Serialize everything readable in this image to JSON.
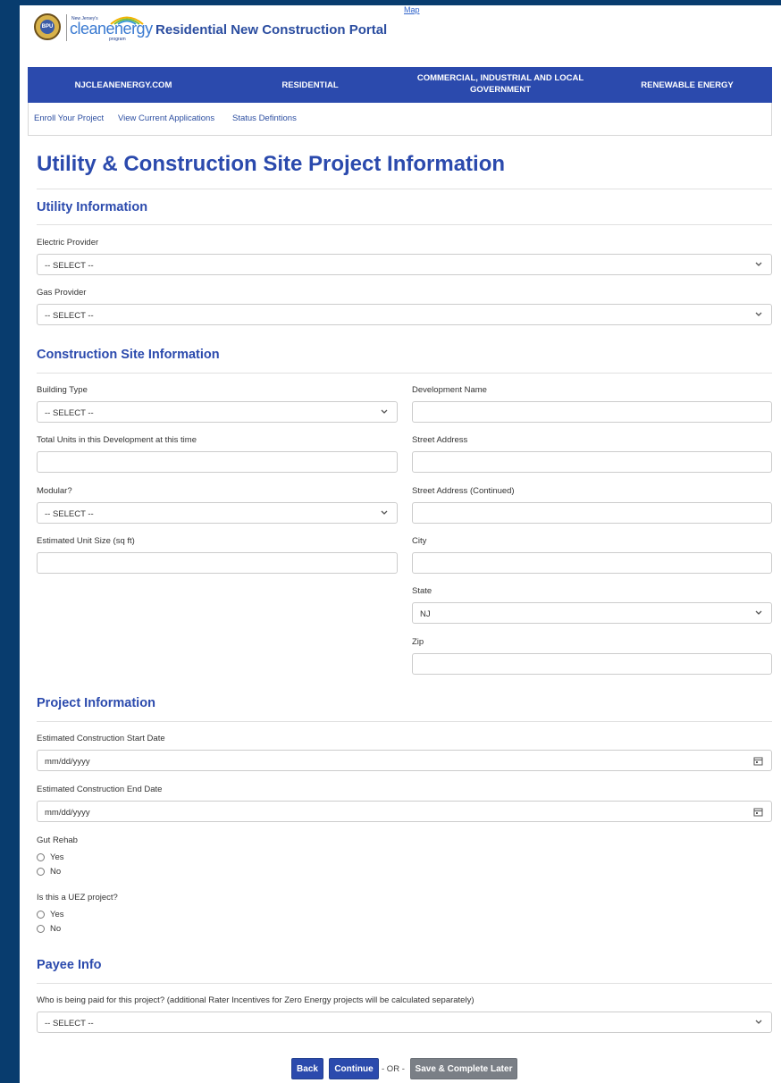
{
  "header": {
    "logo_small": "New Jersey's",
    "logo_text": "cleanenergy",
    "logo_program": "program",
    "seal_text": "BPU",
    "portal_title": "Residential New Construction Portal",
    "map_link": "Map"
  },
  "nav": {
    "items": [
      {
        "label": "NJCLEANENERGY.COM"
      },
      {
        "label": "RESIDENTIAL"
      },
      {
        "label": "COMMERCIAL, INDUSTRIAL AND LOCAL GOVERNMENT"
      },
      {
        "label": "RENEWABLE ENERGY"
      }
    ]
  },
  "subnav": {
    "items": [
      {
        "label": "Enroll Your Project"
      },
      {
        "label": "View Current Applications"
      },
      {
        "label": "Status Defintions"
      }
    ]
  },
  "page_title": "Utility & Construction Site Project Information",
  "utility": {
    "heading": "Utility Information",
    "electric_label": "Electric Provider",
    "electric_value": "-- SELECT --",
    "gas_label": "Gas Provider",
    "gas_value": "-- SELECT --"
  },
  "site": {
    "heading": "Construction Site Information",
    "building_type_label": "Building Type",
    "building_type_value": "-- SELECT --",
    "total_units_label": "Total Units in this Development at this time",
    "modular_label": "Modular?",
    "modular_value": "-- SELECT --",
    "unit_size_label": "Estimated Unit Size (sq ft)",
    "development_name_label": "Development Name",
    "street_label": "Street Address",
    "street2_label": "Street Address (Continued)",
    "city_label": "City",
    "state_label": "State",
    "state_value": "NJ",
    "zip_label": "Zip"
  },
  "project": {
    "heading": "Project Information",
    "start_label": "Estimated Construction Start Date",
    "start_placeholder": "mm/dd/yyyy",
    "end_label": "Estimated Construction End Date",
    "end_placeholder": "mm/dd/yyyy",
    "gut_rehab_label": "Gut Rehab",
    "uez_label": "Is this a UEZ project?",
    "yes": "Yes",
    "no": "No"
  },
  "payee": {
    "heading": "Payee Info",
    "question": "Who is being paid for this project? (additional Rater Incentives for Zero Energy projects will be calculated separately)",
    "value": "-- SELECT --"
  },
  "actions": {
    "back": "Back",
    "continue": "Continue",
    "or": "- OR -",
    "save": "Save & Complete Later"
  },
  "colors": {
    "brand_blue": "#2b4aad",
    "frame": "#083c6e",
    "secondary_button": "#7a7f86"
  }
}
